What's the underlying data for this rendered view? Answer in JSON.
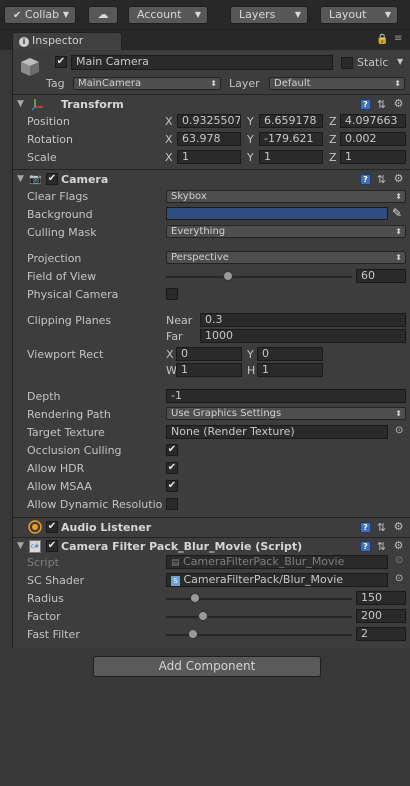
{
  "toolbar": {
    "collab_label": "Collab",
    "account_label": "Account",
    "layers_label": "Layers",
    "layout_label": "Layout"
  },
  "tab": {
    "label": "Inspector"
  },
  "gameobject": {
    "name": "Main Camera",
    "static_label": "Static",
    "tag_label": "Tag",
    "tag_value": "MainCamera",
    "layer_label": "Layer",
    "layer_value": "Default"
  },
  "transform": {
    "title": "Transform",
    "position_label": "Position",
    "rotation_label": "Rotation",
    "scale_label": "Scale",
    "axis_x": "X",
    "axis_y": "Y",
    "axis_z": "Z",
    "position": {
      "x": "0.9325507",
      "y": "6.659178",
      "z": "4.097663"
    },
    "rotation": {
      "x": "63.978",
      "y": "-179.621",
      "z": "0.002"
    },
    "scale": {
      "x": "1",
      "y": "1",
      "z": "1"
    }
  },
  "camera": {
    "title": "Camera",
    "clear_flags_label": "Clear Flags",
    "clear_flags_value": "Skybox",
    "background_label": "Background",
    "background_color": "#2f4f82",
    "culling_mask_label": "Culling Mask",
    "culling_mask_value": "Everything",
    "projection_label": "Projection",
    "projection_value": "Perspective",
    "fov_label": "Field of View",
    "fov_value": "60",
    "fov_min": 1,
    "fov_max": 179,
    "physical_camera_label": "Physical Camera",
    "clipping_planes_label": "Clipping Planes",
    "near_label": "Near",
    "near_value": "0.3",
    "far_label": "Far",
    "far_value": "1000",
    "viewport_rect_label": "Viewport Rect",
    "vp_x_label": "X",
    "vp_x_value": "0",
    "vp_y_label": "Y",
    "vp_y_value": "0",
    "vp_w_label": "W",
    "vp_w_value": "1",
    "vp_h_label": "H",
    "vp_h_value": "1",
    "depth_label": "Depth",
    "depth_value": "-1",
    "rendering_path_label": "Rendering Path",
    "rendering_path_value": "Use Graphics Settings",
    "target_texture_label": "Target Texture",
    "target_texture_value": "None (Render Texture)",
    "occlusion_label": "Occlusion Culling",
    "hdr_label": "Allow HDR",
    "msaa_label": "Allow MSAA",
    "dynamic_res_label": "Allow Dynamic Resolutio"
  },
  "audio_listener": {
    "title": "Audio Listener"
  },
  "filter_script": {
    "title": "Camera Filter Pack_Blur_Movie (Script)",
    "script_label": "Script",
    "script_value": "CameraFilterPack_Blur_Movie",
    "shader_label": "SC Shader",
    "shader_value": "CameraFilterPack/Blur_Movie",
    "radius_label": "Radius",
    "radius_value": "150",
    "factor_label": "Factor",
    "factor_value": "200",
    "fast_filter_label": "Fast Filter",
    "fast_filter_value": "2"
  },
  "add_component_label": "Add Component",
  "colors": {
    "panel_bg": "#3d3d3d",
    "toolbar_bg": "#282828",
    "field_bg": "#2a2a2a",
    "accent_blue": "#3f6fb5"
  }
}
